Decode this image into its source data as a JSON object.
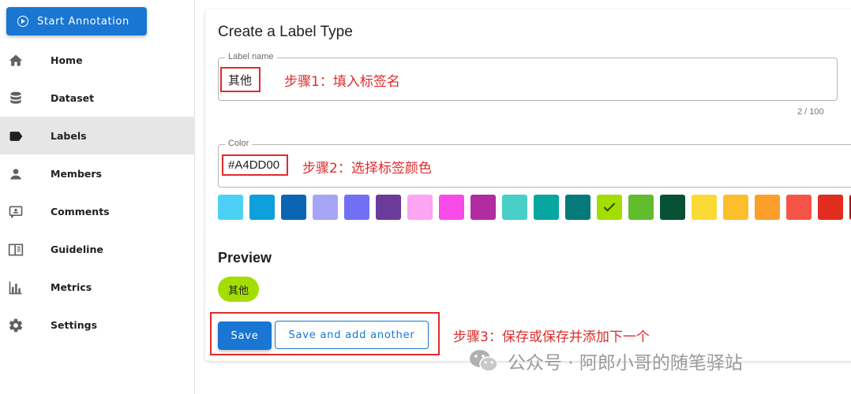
{
  "sidebar": {
    "start_button_label": "Start Annotation",
    "items": [
      {
        "label": "Home",
        "icon": "home-icon"
      },
      {
        "label": "Dataset",
        "icon": "database-icon"
      },
      {
        "label": "Labels",
        "icon": "label-icon",
        "active": true
      },
      {
        "label": "Members",
        "icon": "person-icon"
      },
      {
        "label": "Comments",
        "icon": "comment-icon"
      },
      {
        "label": "Guideline",
        "icon": "book-icon"
      },
      {
        "label": "Metrics",
        "icon": "bar-chart-icon"
      },
      {
        "label": "Settings",
        "icon": "gear-icon"
      }
    ]
  },
  "form": {
    "title": "Create a Label Type",
    "label_name": {
      "legend": "Label name",
      "value": "其他",
      "counter": "2 / 100"
    },
    "color": {
      "legend": "Color",
      "value": "#A4DD00"
    },
    "palette": [
      "#4DD0F5",
      "#0EA0DA",
      "#0A66B2",
      "#A6A5F5",
      "#716FF4",
      "#6B3B99",
      "#FCA5F3",
      "#F84AE8",
      "#B12CA0",
      "#47CFC8",
      "#08A6A0",
      "#067A7A",
      "#A4DD00",
      "#61BB2B",
      "#065233",
      "#FBD936",
      "#FBBF2C",
      "#FB9E2A",
      "#F75448",
      "#E12D20",
      "#B00000"
    ],
    "selected_color": "#A4DD00"
  },
  "preview": {
    "title": "Preview",
    "chip_label": "其他"
  },
  "actions": {
    "save_label": "Save",
    "save_another_label": "Save and add another"
  },
  "annotations": {
    "step1": "步骤1：填入标签名",
    "step2": "步骤2：选择标签颜色",
    "step3": "步骤3：保存或保存并添加下一个"
  },
  "watermark": {
    "text": "公众号 · 阿郎小哥的随笔驿站"
  },
  "colors": {
    "primary": "#1976d2",
    "annotation_red": "#e02b2b"
  }
}
